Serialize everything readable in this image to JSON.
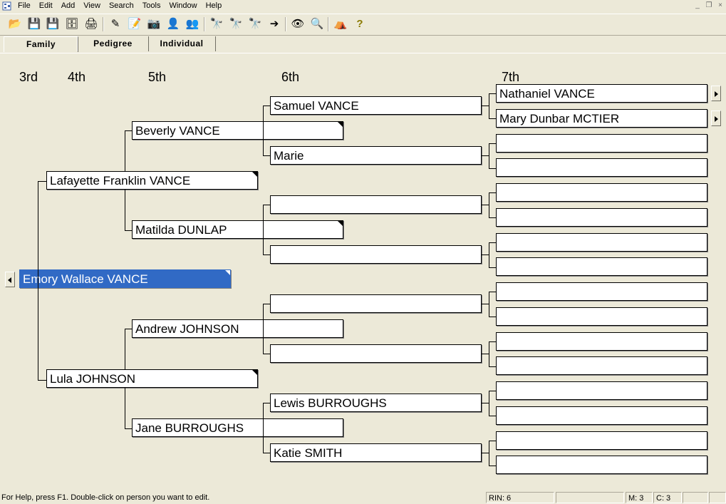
{
  "menu": {
    "items": [
      "File",
      "Edit",
      "Add",
      "View",
      "Search",
      "Tools",
      "Window",
      "Help"
    ],
    "window_controls": [
      "_",
      "❐",
      "×"
    ]
  },
  "toolbar": {
    "buttons": [
      {
        "name": "open-icon",
        "glyph": "📂"
      },
      {
        "name": "save-icon",
        "glyph": "💾"
      },
      {
        "name": "save-as-icon",
        "glyph": "💾"
      },
      {
        "name": "backup-icon",
        "glyph": "🗄"
      },
      {
        "name": "print-icon",
        "glyph": "🖨"
      },
      {
        "name": "edit-person-icon",
        "glyph": "✎"
      },
      {
        "name": "notes-icon",
        "glyph": "📝"
      },
      {
        "name": "multimedia-icon",
        "glyph": "📷"
      },
      {
        "name": "add-person-icon",
        "glyph": "👤"
      },
      {
        "name": "add-family-icon",
        "glyph": "👥"
      },
      {
        "name": "find-icon",
        "glyph": "🔭"
      },
      {
        "name": "find-next-icon",
        "glyph": "🔭"
      },
      {
        "name": "find-previous-icon",
        "glyph": "🔭"
      },
      {
        "name": "goto-icon",
        "glyph": "➔"
      },
      {
        "name": "relationship-icon",
        "glyph": "👁"
      },
      {
        "name": "web-search-icon",
        "glyph": "🔍"
      },
      {
        "name": "tree-icon",
        "glyph": "⛺"
      },
      {
        "name": "help-icon",
        "glyph": "?"
      }
    ]
  },
  "tabs": [
    {
      "label": "Family"
    },
    {
      "label": "Pedigree"
    },
    {
      "label": "Individual"
    }
  ],
  "generations": [
    "3rd",
    "4th",
    "5th",
    "6th",
    "7th"
  ],
  "pedigree": {
    "root": "Emory Wallace VANCE",
    "gen4": [
      "Lafayette Franklin VANCE",
      "Lula JOHNSON"
    ],
    "gen5": [
      "Beverly VANCE",
      "Matilda DUNLAP",
      "Andrew JOHNSON",
      "Jane BURROUGHS"
    ],
    "gen6": [
      "Samuel VANCE",
      "Marie",
      "",
      "",
      "",
      "",
      "Lewis BURROUGHS",
      "Katie SMITH"
    ],
    "gen7": [
      "Nathaniel VANCE",
      "Mary Dunbar MCTIER",
      "",
      "",
      "",
      "",
      "",
      "",
      "",
      "",
      "",
      "",
      "",
      "",
      "",
      ""
    ]
  },
  "status": {
    "help": "For Help, press F1. Double-click on person you want to edit.",
    "rin": "RIN: 6",
    "m": "M: 3",
    "c": "C: 3"
  }
}
